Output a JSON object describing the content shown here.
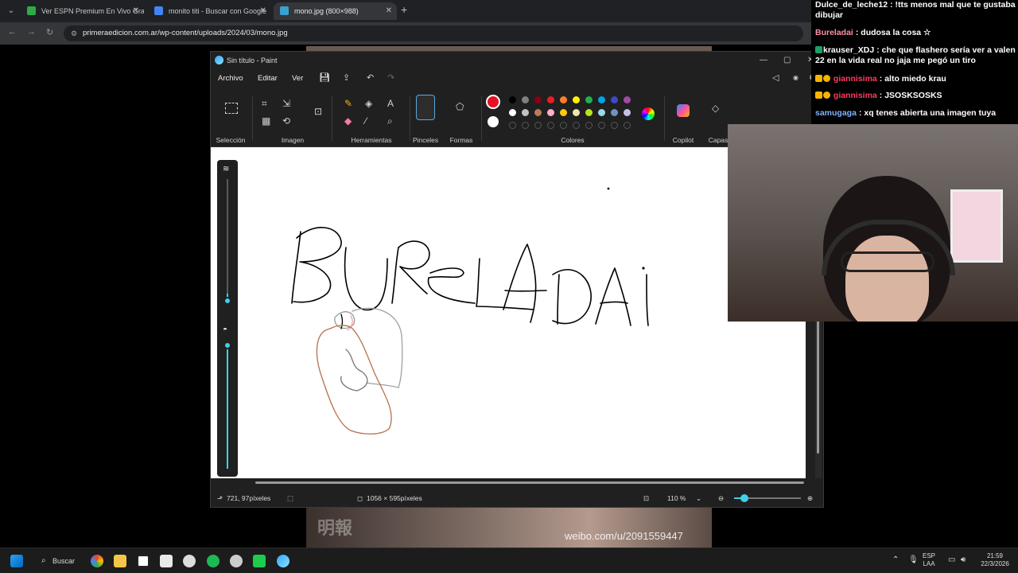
{
  "browser": {
    "tabs": [
      {
        "title": "Ver ESPN Premium En Vivo Gra",
        "favicon_color": "#2eaa4a",
        "active": false
      },
      {
        "title": "monito titi - Buscar con Google",
        "favicon_color": "#4285f4",
        "active": false
      },
      {
        "title": "mono.jpg (800×988)",
        "favicon_color": "#3aa0d0",
        "active": true
      }
    ],
    "url": "primeraedicion.com.ar/wp-content/uploads/2024/03/mono.jpg"
  },
  "background_image": {
    "watermark_left": "明報",
    "watermark_right": "weibo.com/u/2091559447"
  },
  "paint": {
    "title": "Sin título - Paint",
    "menus": [
      "Archivo",
      "Editar",
      "Ver"
    ],
    "ribbon_groups": {
      "seleccion": "Selección",
      "imagen": "Imagen",
      "herramientas": "Herramientas",
      "pinceles": "Pinceles",
      "formas": "Formas",
      "colores": "Colores",
      "copilot": "Copilot",
      "capas": "Capas"
    },
    "primary_color": "#e81123",
    "secondary_color": "#ffffff",
    "palette_row1": [
      "#000000",
      "#7f7f7f",
      "#880015",
      "#ed1c24",
      "#ff7f27",
      "#fff200",
      "#22b14c",
      "#00a2e8",
      "#3f48cc",
      "#a349a4"
    ],
    "palette_row2": [
      "#ffffff",
      "#c3c3c3",
      "#b97a57",
      "#ffaec9",
      "#ffc90e",
      "#efe4b0",
      "#b5e61d",
      "#99d9ea",
      "#7092be",
      "#c8bfe7"
    ],
    "drawing_text": "BURELADAI",
    "status": {
      "cursor_pos": "721, 97píxeles",
      "canvas_size": "1056 × 595píxeles",
      "zoom": "110 %"
    }
  },
  "chat": [
    {
      "user": "Dulce_de_leche12",
      "user_color": "#ffffff",
      "message": "!tts menos mal que te gustaba dibujar",
      "badges": []
    },
    {
      "user": "Bureladai",
      "user_color": "#ff8fa3",
      "message": "dudosa la cosa ☆",
      "badges": []
    },
    {
      "user": "krauser_XDJ",
      "user_color": "#ffffff",
      "message": "che que flashero sería ver a valen 22 en la vida real no jaja me pegó un tiro",
      "badges": [
        "#1e9e6a"
      ]
    },
    {
      "user": "giannisima",
      "user_color": "#ff3b5c",
      "message": "alto miedo krau",
      "badges": [
        "#f5b400",
        "#f5b400"
      ]
    },
    {
      "user": "giannisima",
      "user_color": "#ff3b5c",
      "message": "JSOSKSOSKS",
      "badges": [
        "#f5b400",
        "#f5b400"
      ]
    },
    {
      "user": "samugaga",
      "user_color": "#7fb2ff",
      "message": "xq tenes abierta una imagen tuya",
      "badges": []
    }
  ],
  "taskbar": {
    "search_label": "Buscar",
    "lang_top": "ESP",
    "lang_bottom": "LAA",
    "time": "21:59",
    "date": "22/3/2026"
  }
}
